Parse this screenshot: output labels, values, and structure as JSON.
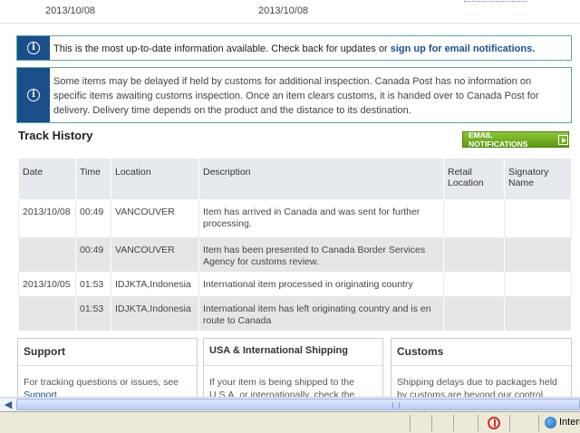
{
  "top_strip": {
    "date_left": "2013/10/08",
    "date_right": "2013/10/08"
  },
  "notices": [
    {
      "text": "This is the most up-to-date information available. Check back for updates or ",
      "link": "sign up for email notifications."
    },
    {
      "text": "Some items may be delayed if held by customs for additional inspection. Canada Post has no information on specific items awaiting customs inspection. Once an item clears customs, it is handed over to Canada Post for delivery. Delivery time depends on the product and the distance to its destination."
    }
  ],
  "track_history": {
    "title": "Track History",
    "email_button": "EMAIL NOTIFICATIONS",
    "columns": [
      "Date",
      "Time",
      "Location",
      "Description",
      "Retail Location",
      "Signatory Name"
    ],
    "rows": [
      {
        "date": "2013/10/08",
        "time": "00:49",
        "location": "VANCOUVER",
        "description": "Item has arrived in Canada and was sent for further processing.",
        "retail": "",
        "signatory": ""
      },
      {
        "date": "",
        "time": "00:49",
        "location": "VANCOUVER",
        "description": "Item has been presented to Canada Border Services Agency for customs review.",
        "retail": "",
        "signatory": ""
      },
      {
        "date": "2013/10/05",
        "time": "01:53",
        "location": "IDJKTA,Indonesia",
        "description": "International item processed in originating country",
        "retail": "",
        "signatory": ""
      },
      {
        "date": "",
        "time": "01:53",
        "location": "IDJKTA,Indonesia",
        "description": "International item has left originating country and is en route to Canada",
        "retail": "",
        "signatory": ""
      }
    ]
  },
  "boxes": [
    {
      "title": "Support",
      "body": "For tracking questions or issues, see",
      "link": "Support"
    },
    {
      "title": "USA & International Shipping",
      "body": "If your item is being shipped to the U.S.A. or internationally, check the"
    },
    {
      "title": "Customs",
      "body": "Shipping delays due to packages held by customs are beyond our control."
    }
  ],
  "status_bar": {
    "zone": "Internet"
  },
  "icons": {
    "info": "info-icon",
    "arrow": "arrow-right-icon",
    "privacy": "privacy-icon",
    "globe": "globe-icon",
    "scroll_left": "scroll-left-icon"
  },
  "colors": {
    "info_cell": "#1a4f8a",
    "notice_border": "#5aa8a0",
    "email_button": "#6fa91f",
    "link": "#1a4f8a"
  }
}
